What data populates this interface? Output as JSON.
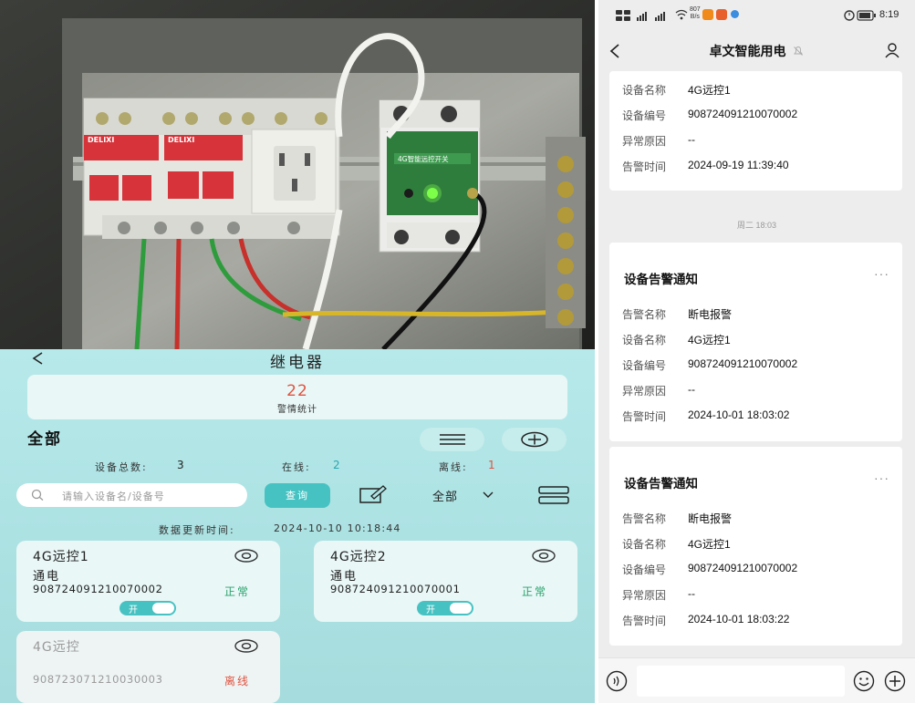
{
  "relay_app": {
    "back_icon": "back-arrow-icon",
    "title": "继电器",
    "alarm_count": "22",
    "alarm_label": "警情统计",
    "filter_title": "全部",
    "total_label": "设备总数:",
    "total_value": "3",
    "online_label": "在线:",
    "online_value": "2",
    "offline_label": "离线:",
    "offline_value": "1",
    "search_placeholder": "请输入设备名/设备号",
    "query_button": "查询",
    "dropdown_value": "全部",
    "updated_label": "数据更新时间:",
    "updated_value": "2024-10-10 10:18:44",
    "devices": [
      {
        "name": "4G远控1",
        "status": "通电",
        "id": "908724091210070002",
        "state": "正常",
        "toggle_label": "开",
        "online": true
      },
      {
        "name": "4G远控2",
        "status": "通电",
        "id": "908724091210070001",
        "state": "正常",
        "toggle_label": "开",
        "online": true
      },
      {
        "name": "4G远控",
        "status": "",
        "id": "908723071210030003",
        "state": "离线",
        "toggle_label": "",
        "online": false
      }
    ],
    "colors": {
      "accent": "#47c2c2",
      "alert": "#e0533f",
      "ok": "#29a36b"
    }
  },
  "chat": {
    "status_bar": {
      "time": "8:19",
      "speed_top": "807",
      "speed_bottom": "B/s"
    },
    "nav_title": "卓文智能用电",
    "partial_card": {
      "rows": [
        {
          "k": "设备名称",
          "v": "4G远控1"
        },
        {
          "k": "设备编号",
          "v": "908724091210070002"
        },
        {
          "k": "异常原因",
          "v": "--"
        },
        {
          "k": "告警时间",
          "v": "2024-09-19 11:39:40"
        }
      ]
    },
    "time_separator": "周二 18:03",
    "cards": [
      {
        "title": "设备告警通知",
        "rows": [
          {
            "k": "告警名称",
            "v": "断电报警"
          },
          {
            "k": "设备名称",
            "v": "4G远控1"
          },
          {
            "k": "设备编号",
            "v": "908724091210070002"
          },
          {
            "k": "异常原因",
            "v": "--"
          },
          {
            "k": "告警时间",
            "v": "2024-10-01 18:03:02"
          }
        ]
      },
      {
        "title": "设备告警通知",
        "rows": [
          {
            "k": "告警名称",
            "v": "断电报警"
          },
          {
            "k": "设备名称",
            "v": "4G远控1"
          },
          {
            "k": "设备编号",
            "v": "908724091210070002"
          },
          {
            "k": "异常原因",
            "v": "--"
          },
          {
            "k": "告警时间",
            "v": "2024-10-01 18:03:22"
          }
        ]
      }
    ],
    "more_icon": "···"
  },
  "photo": {
    "breaker_brand": "DELIXI",
    "breaker_brand_2": "DELIXI",
    "device_label": "4G智能远控开关"
  }
}
